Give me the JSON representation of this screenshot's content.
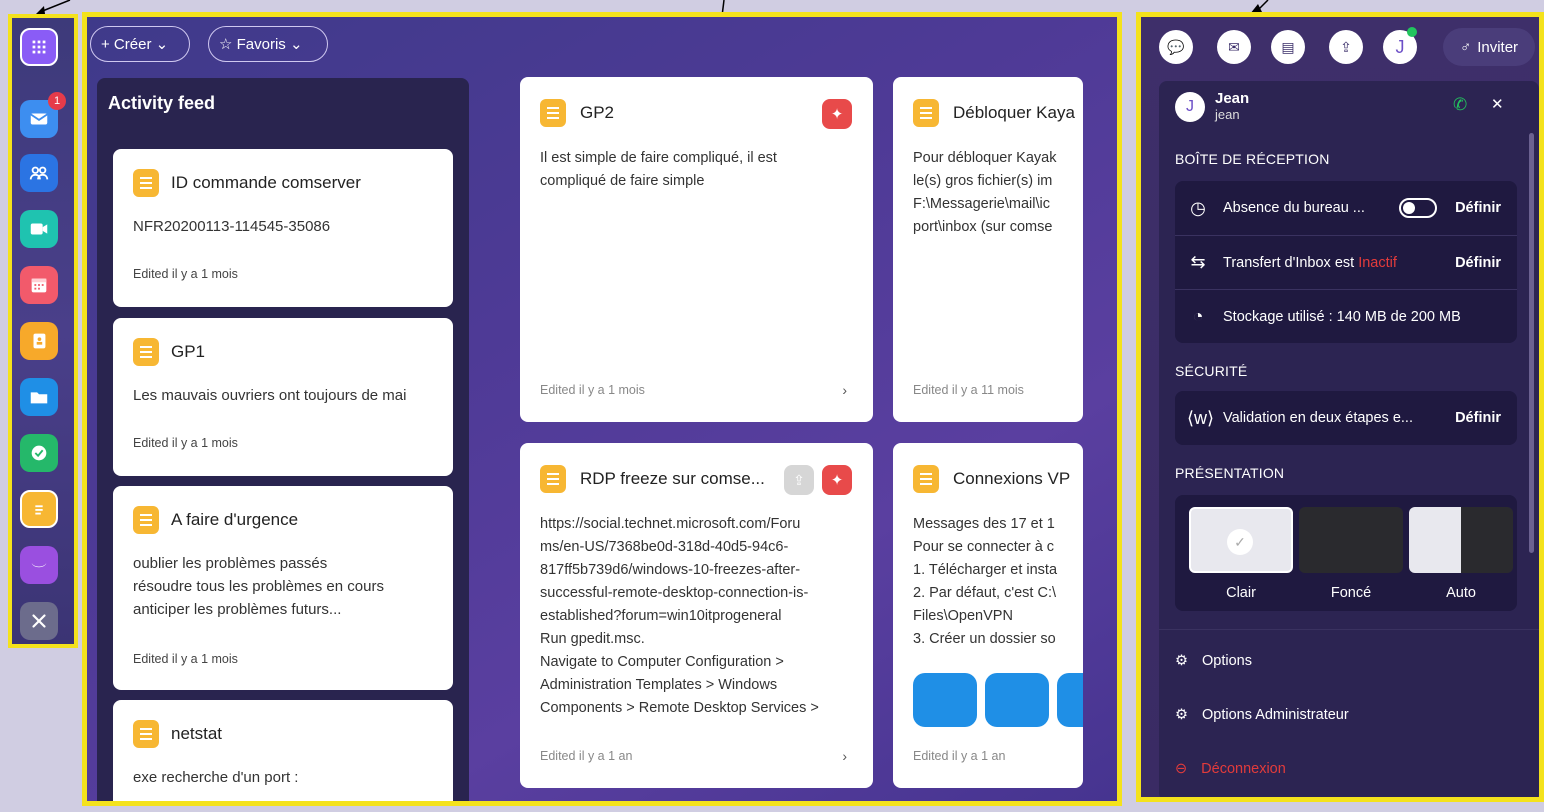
{
  "sidebar": {
    "badge_count": "1",
    "apps": [
      "apps-grid",
      "mail",
      "contacts",
      "video",
      "calendar",
      "address-book",
      "files",
      "tasks",
      "notes",
      "brand",
      "tools"
    ]
  },
  "topbar": {
    "create_label": "+ Créer ⌄",
    "favorites_label": "☆ Favoris ⌄"
  },
  "feed": {
    "title": "Activity feed",
    "items": [
      {
        "title": "ID commande comserver",
        "text": "NFR20200113-114545-35086",
        "edited": "Edited il y a 1 mois"
      },
      {
        "title": "GP1",
        "text": "Les mauvais ouvriers ont toujours de mai",
        "edited": "Edited il y a 1 mois"
      },
      {
        "title": "A faire d'urgence",
        "text1": "oublier les problèmes passés",
        "text2": "résoudre tous les problèmes en cours",
        "text3": "anticiper les problèmes futurs...",
        "edited": "Edited il y a 1 mois"
      },
      {
        "title": "netstat",
        "text": "exe recherche d'un port :"
      }
    ]
  },
  "notes": [
    {
      "title": "GP2",
      "text1": "Il est simple de faire compliqué, il est",
      "text2": "compliqué de faire simple",
      "edited": "Edited il y a 1 mois",
      "chevron": "›"
    },
    {
      "title": "Débloquer Kaya",
      "text1": "Pour débloquer Kayak",
      "text2": "le(s) gros fichier(s) im",
      "text3": "F:\\Messagerie\\mail\\ic",
      "text4": "port\\inbox (sur comse",
      "edited": "Edited il y a 11 mois"
    },
    {
      "title": "RDP freeze sur comse...",
      "lines": [
        "https://social.technet.microsoft.com/Foru",
        "ms/en-US/7368be0d-318d-40d5-94c6-",
        "817ff5b739d6/windows-10-freezes-after-",
        "successful-remote-desktop-connection-is-",
        "established?forum=win10itprogeneral",
        "Run gpedit.msc.",
        "Navigate to Computer Configuration >",
        "Administration Templates > Windows",
        "Components > Remote Desktop Services >"
      ],
      "edited": "Edited il y a 1 an",
      "chevron": "›"
    },
    {
      "title": "Connexions VP",
      "lines": [
        "Messages des 17 et 1",
        "Pour se connecter à c",
        "1. Télécharger et insta",
        "2. Par défaut, c'est C:\\",
        "Files\\OpenVPN",
        "3. Créer un dossier so"
      ],
      "edited": "Edited il y a 1 an"
    }
  ],
  "rpanel": {
    "invite_label": "Inviter",
    "user": {
      "initial": "J",
      "name": "Jean",
      "login": "jean"
    },
    "header_avatar": "J",
    "close": "✕",
    "inbox_section": "BOÎTE DE RÉCEPTION",
    "absence": "Absence du bureau ...",
    "define": "Définir",
    "transfer_prefix": "Transfert d'Inbox est ",
    "transfer_status": "Inactif",
    "storage": "Stockage utilisé : 140 MB de 200 MB",
    "security_section": "SÉCURITÉ",
    "two_step": "Validation en deux étapes e...",
    "presentation_section": "PRÉSENTATION",
    "themes": [
      "Clair",
      "Foncé",
      "Auto"
    ],
    "options": "Options",
    "admin_options": "Options Administrateur",
    "logout": "Déconnexion"
  },
  "colors": {
    "accent": "#f4e21c",
    "pin": "#e84a4a",
    "inactive": "#e23b3b",
    "logout": "#e23b3b"
  }
}
